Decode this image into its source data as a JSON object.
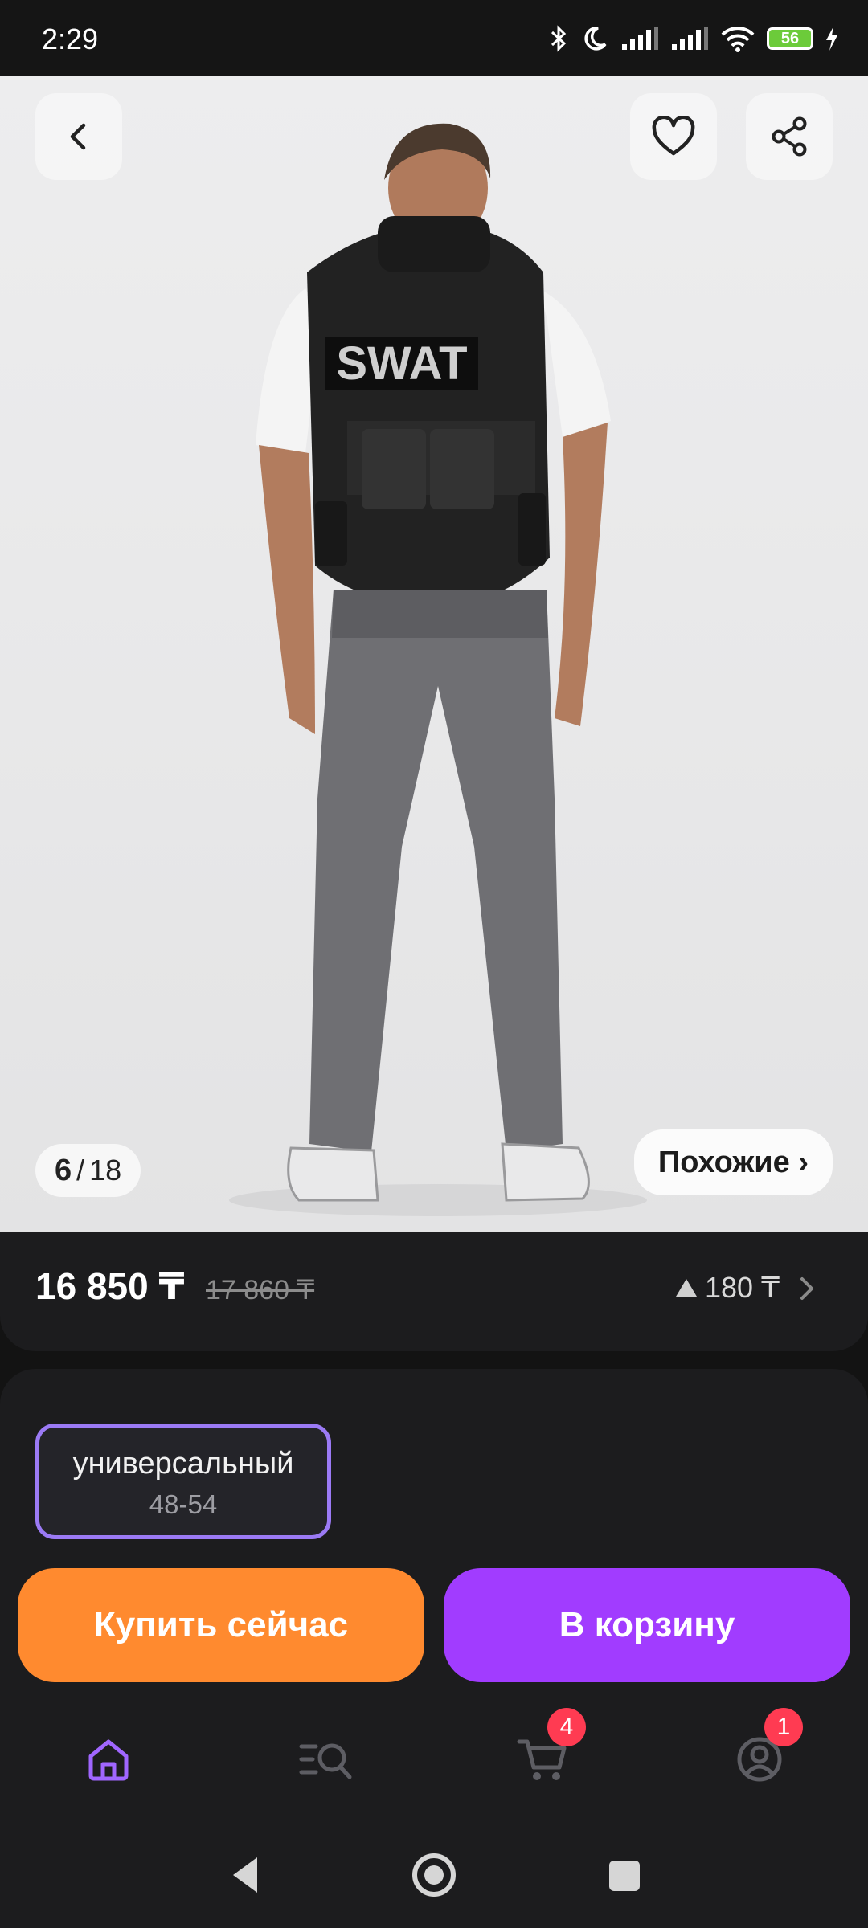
{
  "status": {
    "time": "2:29",
    "battery": "56"
  },
  "gallery": {
    "current": "6",
    "separator": "/",
    "total": "18",
    "similar_label": "Похожие ›"
  },
  "product": {
    "price": "16 850 ₸",
    "old_price": "17 860 ₸",
    "change": "180 ₸"
  },
  "size_option": {
    "name": "универсальный",
    "range": "48-54"
  },
  "actions": {
    "buy_now": "Купить сейчас",
    "add_to_cart": "В корзину"
  },
  "tabbar": {
    "cart_badge": "4",
    "profile_badge": "1"
  },
  "colors": {
    "accent_purple": "#a13cff",
    "accent_orange": "#ff8a2f",
    "selected_border": "#9b7af5",
    "badge": "#ff3b52",
    "background": "#131313"
  }
}
